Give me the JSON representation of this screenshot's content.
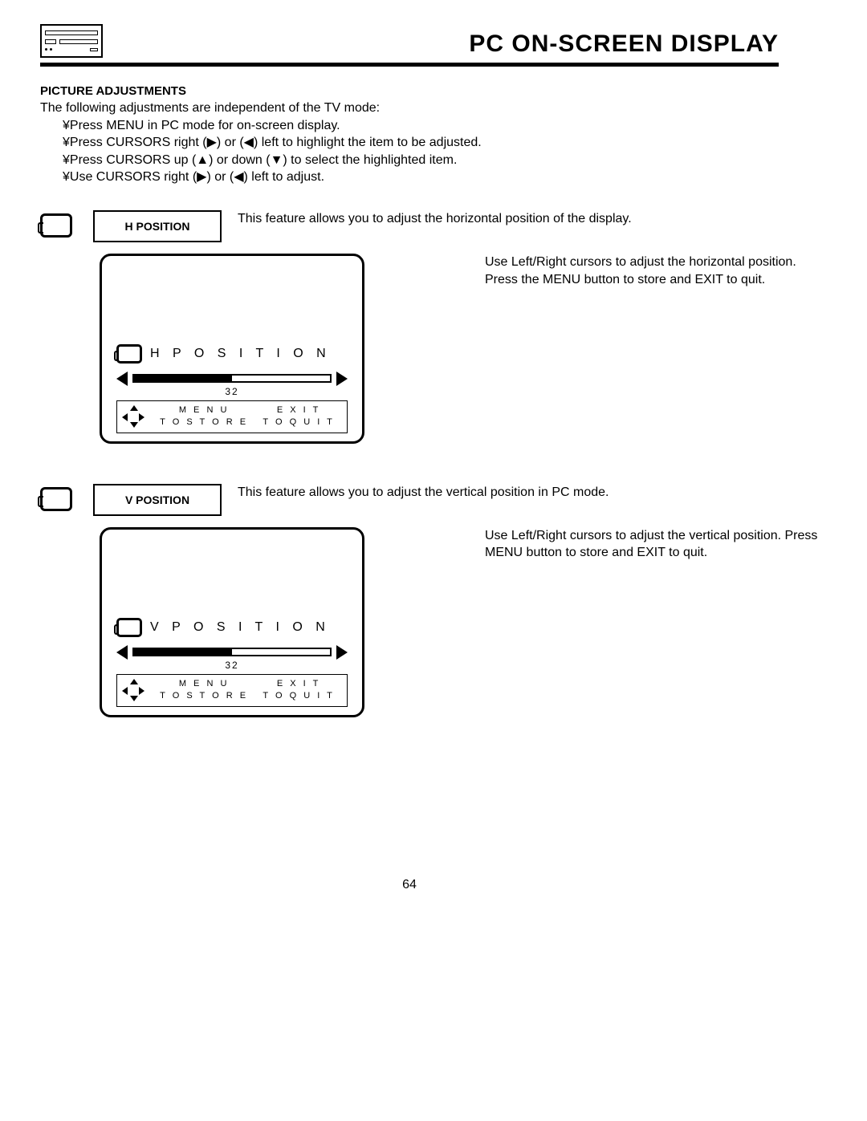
{
  "header": {
    "title": "PC ON-SCREEN DISPLAY"
  },
  "section": {
    "heading": "PICTURE ADJUSTMENTS",
    "intro": "The following adjustments are independent of the TV mode:",
    "bullets": [
      "¥Press MENU in PC mode for on-screen display.",
      "¥Press CURSORS right (▶) or (◀) left to highlight the item to be adjusted.",
      "¥Press CURSORS up (▲) or down (▼) to select the highlighted item.",
      "¥Use CURSORS right (▶) or (◀) left to adjust."
    ]
  },
  "features": [
    {
      "label": "H POSITION",
      "description": "This feature allows you to adjust the horizontal position of the display.",
      "instruction": "Use Left/Right cursors to adjust the horizontal position. Press the MENU button to store and EXIT to quit.",
      "osd": {
        "title": "H   P O S I T I O N",
        "value": "32",
        "menu_line1": "M E N U",
        "menu_line2": "T O   S T O R E",
        "exit_line1": "E X I T",
        "exit_line2": "T O   Q U I T"
      }
    },
    {
      "label": "V POSITION",
      "description": "This feature allows you to adjust the vertical position in PC mode.",
      "instruction": "Use Left/Right cursors to adjust the vertical position. Press MENU button to store and EXIT to quit.",
      "osd": {
        "title": "V   P O S I T I O N",
        "value": "32",
        "menu_line1": "M E N U",
        "menu_line2": "T O   S T O R E",
        "exit_line1": "E X I T",
        "exit_line2": "T O   Q U I T"
      }
    }
  ],
  "page_number": "64"
}
